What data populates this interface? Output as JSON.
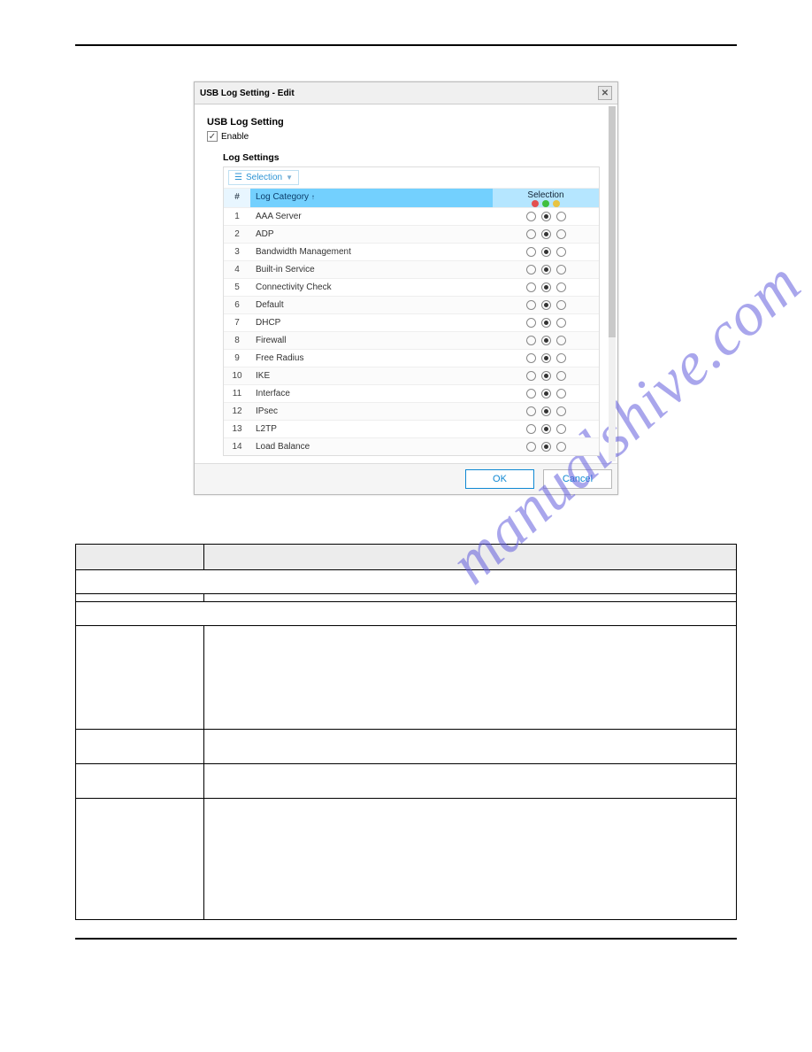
{
  "watermark_text": "manualshive.com",
  "dialog": {
    "title": "USB Log Setting - Edit",
    "section_title": "USB Log Setting",
    "enable_label": "Enable",
    "enable_checked": true,
    "log_settings_title": "Log Settings",
    "selection_btn_label": "Selection",
    "col_num": "#",
    "col_category": "Log Category",
    "col_selection": "Selection",
    "ok_label": "OK",
    "cancel_label": "Cancel",
    "rows": [
      {
        "n": "1",
        "cat": "AAA Server",
        "sel": 1
      },
      {
        "n": "2",
        "cat": "ADP",
        "sel": 1
      },
      {
        "n": "3",
        "cat": "Bandwidth Management",
        "sel": 1
      },
      {
        "n": "4",
        "cat": "Built-in Service",
        "sel": 1
      },
      {
        "n": "5",
        "cat": "Connectivity Check",
        "sel": 1
      },
      {
        "n": "6",
        "cat": "Default",
        "sel": 1
      },
      {
        "n": "7",
        "cat": "DHCP",
        "sel": 1
      },
      {
        "n": "8",
        "cat": "Firewall",
        "sel": 1
      },
      {
        "n": "9",
        "cat": "Free Radius",
        "sel": 1
      },
      {
        "n": "10",
        "cat": "IKE",
        "sel": 1
      },
      {
        "n": "11",
        "cat": "Interface",
        "sel": 1
      },
      {
        "n": "12",
        "cat": "IPsec",
        "sel": 1
      },
      {
        "n": "13",
        "cat": "L2TP",
        "sel": 1
      },
      {
        "n": "14",
        "cat": "Load Balance",
        "sel": 1
      }
    ]
  }
}
